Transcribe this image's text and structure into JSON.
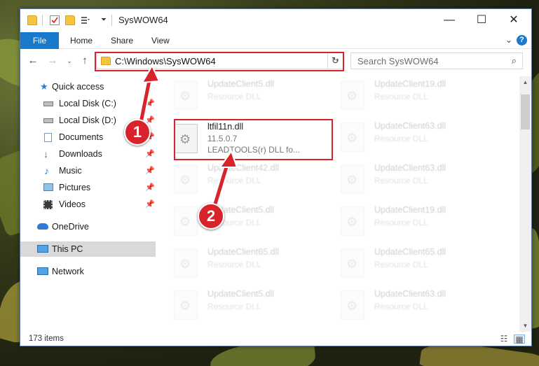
{
  "window": {
    "title": "SysWOW64",
    "minimize": "—",
    "maximize": "☐",
    "close": "✕"
  },
  "ribbon": {
    "tabs": [
      "File",
      "Home",
      "Share",
      "View"
    ],
    "expand": "⌄",
    "help": "?"
  },
  "address": {
    "path": "C:\\Windows\\SysWOW64",
    "search_placeholder": "Search SysWOW64"
  },
  "nav": {
    "items": [
      {
        "label": "Quick access",
        "icon": "star-icon",
        "pinned": false
      },
      {
        "label": "Local Disk (C:)",
        "icon": "drive-icon",
        "pinned": true
      },
      {
        "label": "Local Disk (D:)",
        "icon": "drive-icon",
        "pinned": true
      },
      {
        "label": "Documents",
        "icon": "documents-icon",
        "pinned": true
      },
      {
        "label": "Downloads",
        "icon": "downloads-icon",
        "pinned": true
      },
      {
        "label": "Music",
        "icon": "music-icon",
        "pinned": true
      },
      {
        "label": "Pictures",
        "icon": "pictures-icon",
        "pinned": true
      },
      {
        "label": "Videos",
        "icon": "videos-icon",
        "pinned": true
      },
      {
        "label": "OneDrive",
        "icon": "cloud-icon",
        "pinned": false
      },
      {
        "label": "This PC",
        "icon": "computer-icon",
        "pinned": false,
        "selected": true
      },
      {
        "label": "Network",
        "icon": "network-icon",
        "pinned": false
      }
    ]
  },
  "files": {
    "left": [
      {
        "name": "UpdateClient5.dll",
        "type": "Resource DLL"
      },
      {
        "name": "UpdateClient42.dll",
        "type": "Resource DLL"
      },
      {
        "name": "UpdateClient5.dll",
        "type": "Resource DLL"
      },
      {
        "name": "UpdateClient65.dll",
        "type": "Resource DLL"
      },
      {
        "name": "UpdateClient5.dll",
        "type": "Resource DLL"
      }
    ],
    "right": [
      {
        "name": "UpdateClient19.dll",
        "type": "Resource DLL"
      },
      {
        "name": "UpdateClient63.dll",
        "type": "Resource DLL"
      },
      {
        "name": "UpdateClient63.dll",
        "type": "Resource DLL"
      },
      {
        "name": "UpdateClient19.dll",
        "type": "Resource DLL"
      },
      {
        "name": "UpdateClient65.dll",
        "type": "Resource DLL"
      },
      {
        "name": "UpdateClient63.dll",
        "type": "Resource DLL"
      }
    ],
    "focus": {
      "name": "ltfil11n.dll",
      "version": "11.5.0.7",
      "description": "LEADTOOLS(r) DLL fo..."
    }
  },
  "status": {
    "item_count": "173 items"
  },
  "annotations": {
    "step1": "1",
    "step2": "2",
    "highlight_color": "#d8232a"
  }
}
